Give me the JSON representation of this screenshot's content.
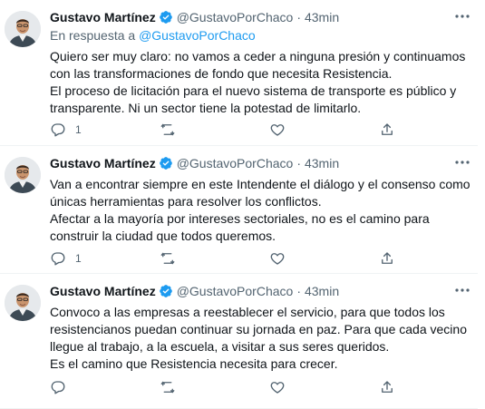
{
  "tweets": [
    {
      "author": {
        "name": "Gustavo Martínez",
        "handle": "@GustavoPorChaco"
      },
      "separator": "·",
      "time": "43min",
      "reply_prefix": "En respuesta a ",
      "reply_mention": "@GustavoPorChaco",
      "paragraphs": [
        "Quiero ser muy claro: no vamos a ceder a ninguna presión y continuamos con las transformaciones de fondo que necesita Resistencia.",
        "El proceso de licitación para el nuevo sistema de transporte es público y transparente. Ni un sector tiene la potestad de limitarlo."
      ],
      "reply_count": "1",
      "retweet_count": "",
      "like_count": ""
    },
    {
      "author": {
        "name": "Gustavo Martínez",
        "handle": "@GustavoPorChaco"
      },
      "separator": "·",
      "time": "43min",
      "paragraphs": [
        "Van a encontrar siempre en este Intendente el diálogo y el consenso como únicas herramientas para resolver los conflictos.",
        "Afectar a la mayoría por intereses sectoriales, no es el camino para construir la ciudad que todos queremos."
      ],
      "reply_count": "1",
      "retweet_count": "",
      "like_count": ""
    },
    {
      "author": {
        "name": "Gustavo Martínez",
        "handle": "@GustavoPorChaco"
      },
      "separator": "·",
      "time": "43min",
      "paragraphs": [
        "Convoco a las empresas a reestablecer el servicio, para que todos los resistencianos puedan continuar su jornada en paz. Para que cada vecino llegue al trabajo, a la escuela, a visitar a sus seres queridos.",
        "Es el camino que Resistencia necesita para crecer."
      ],
      "reply_count": "",
      "retweet_count": "",
      "like_count": ""
    }
  ],
  "colors": {
    "text": "#0f1419",
    "secondary": "#536471",
    "link": "#1d9bf0",
    "verified": "#1d9bf0",
    "divider": "#eff3f4"
  },
  "icons": {
    "verified": "verified-badge-icon",
    "more": "more-options-icon",
    "reply": "reply-icon",
    "retweet": "retweet-icon",
    "like": "heart-icon",
    "share": "share-icon"
  }
}
